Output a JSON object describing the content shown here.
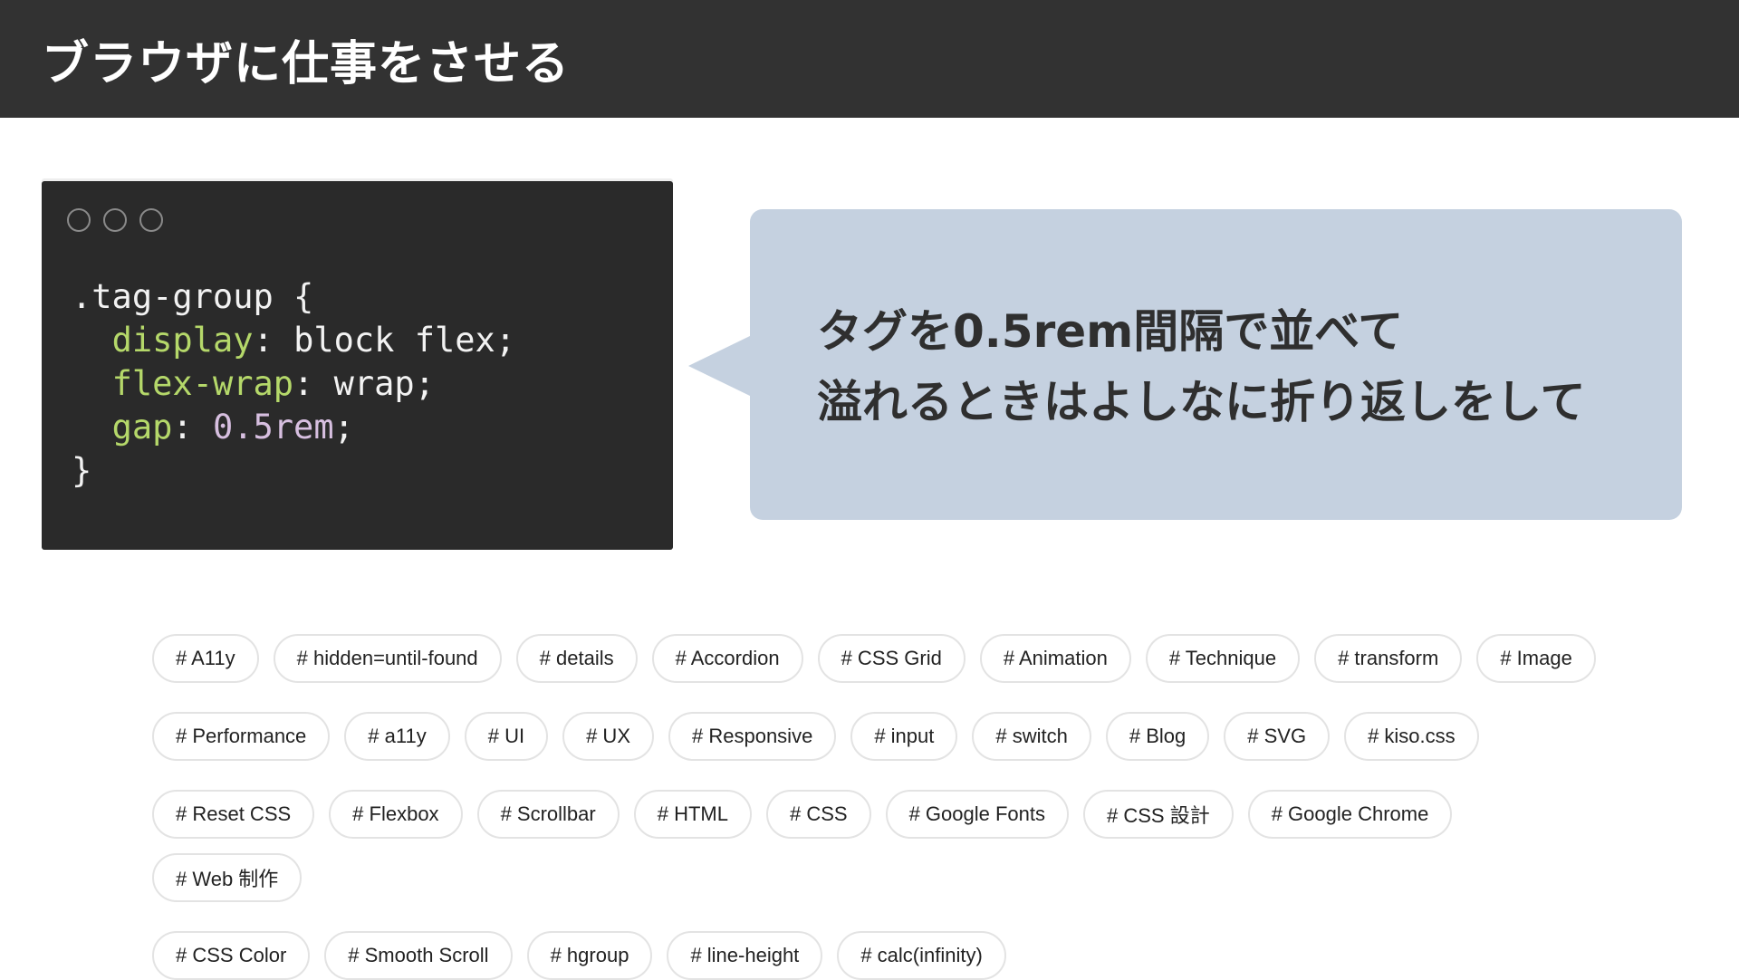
{
  "header": {
    "title": "ブラウザに仕事をさせる"
  },
  "code": {
    "selector_line": ".tag-group {",
    "lines": [
      {
        "prop": "display",
        "sep": ": ",
        "value": "block flex",
        "end": ";"
      },
      {
        "prop": "flex-wrap",
        "sep": ": ",
        "value": "wrap",
        "end": ";"
      },
      {
        "prop": "gap",
        "sep": ": ",
        "value": "0.5rem",
        "end": ";"
      }
    ],
    "closing": "}"
  },
  "bubble": {
    "line1": "タグを0.5rem間隔で並べて",
    "line2": "溢れるときはよしなに折り返しをして"
  },
  "tag_rows": [
    [
      "# A11y",
      "# hidden=until-found",
      "# details",
      "# Accordion",
      "# CSS Grid",
      "# Animation",
      "# Technique",
      "# transform",
      "# Image"
    ],
    [
      "# Performance",
      "# a11y",
      "# UI",
      "# UX",
      "# Responsive",
      "# input",
      "# switch",
      "# Blog",
      "# SVG",
      "# kiso.css"
    ],
    [
      "# Reset CSS",
      "# Flexbox",
      "# Scrollbar",
      "# HTML",
      "# CSS",
      "# Google Fonts",
      "# CSS 設計",
      "# Google Chrome",
      "# Web 制作"
    ],
    [
      "# CSS Color",
      "# Smooth Scroll",
      "# hgroup",
      "# line-height",
      "# calc(infinity)"
    ]
  ],
  "colors": {
    "header_bg": "#323232",
    "code_bg": "#2a2a2a",
    "code_prop": "#b5d86a",
    "code_number": "#d7bfe0",
    "bubble_bg": "#c5d1e0"
  }
}
